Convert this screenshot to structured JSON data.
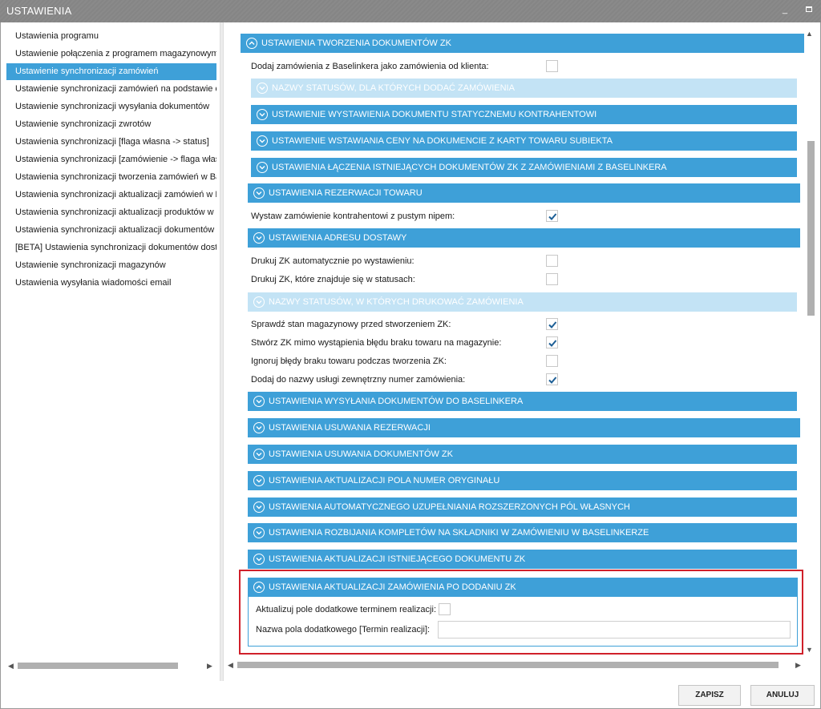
{
  "window": {
    "title": "USTAWIENIA",
    "min_symbol": "_"
  },
  "sidebar": {
    "items": [
      {
        "label": "Ustawienia programu"
      },
      {
        "label": "Ustawienie połączenia z programem magazynowym"
      },
      {
        "label": "Ustawienie synchronizacji zamówień"
      },
      {
        "label": "Ustawienie synchronizacji zamówień na podstawie dzi"
      },
      {
        "label": "Ustawienie synchronizacji wysyłania dokumentów"
      },
      {
        "label": "Ustawienie synchronizacji zwrotów"
      },
      {
        "label": "Ustawienia synchronizacji [flaga własna -> status]"
      },
      {
        "label": "Ustawienia synchronizacji [zamówienie -> flaga własn"
      },
      {
        "label": "Ustawienia synchronizacji tworzenia zamówień w Base"
      },
      {
        "label": "Ustawienia synchronizacji aktualizacji zamówień w Bas"
      },
      {
        "label": "Ustawienia synchronizacji aktualizacji produktów w Ba"
      },
      {
        "label": "Ustawienia synchronizacji aktualizacji dokumentów"
      },
      {
        "label": "[BETA] Ustawienia synchronizacji dokumentów dostaw"
      },
      {
        "label": "Ustawienie synchronizacji magazynów"
      },
      {
        "label": "Ustawienia wysyłania wiadomości email"
      }
    ],
    "active_index": 2
  },
  "main": {
    "header_tworzenie": "USTAWIENIA TWORZENIA DOKUMENTÓW ZK",
    "dodaj_label": "Dodaj zamówienia z Baselinkera jako zamówienia od klienta:",
    "sec_statusy_dodac": "NAZWY STATUSÓW, DLA KTÓRYCH DODAĆ ZAMÓWIENIA",
    "sec_statyczny": "USTAWIENIE WYSTAWIENIA DOKUMENTU STATYCZNEMU KONTRAHENTOWI",
    "sec_ceny": "USTAWIENIE WSTAWIANIA CENY NA DOKUMENCIE Z KARTY TOWARU SUBIEKTA",
    "sec_laczenie": "USTAWIENIA ŁĄCZENIA ISTNIEJĄCYCH DOKUMENTÓW ZK Z ZAMÓWIENIAMI Z BASELINKERA",
    "sec_rezerwacja": "USTAWIENIA REZERWACJI TOWARU",
    "nip_label": "Wystaw zamówienie kontrahentowi z pustym nipem:",
    "sec_adres": "USTAWIENIA ADRESU DOSTAWY",
    "drukuj_auto_label": "Drukuj ZK automatycznie po wystawieniu:",
    "drukuj_status_label": "Drukuj ZK, które znajduje się w statusach:",
    "sec_statusy_drukowac": "NAZWY STATUSÓW, W KTÓRYCH DRUKOWAĆ ZAMÓWIENIA",
    "stan_label": "Sprawdź stan magazynowy przed stworzeniem ZK:",
    "stworz_label": "Stwórz ZK mimo wystąpienia błędu braku towaru na magazynie:",
    "ignoruj_label": "Ignoruj błędy braku towaru podczas tworzenia ZK:",
    "numer_label": "Dodaj do nazwy usługi zewnętrzny numer zamówienia:",
    "sec_wysylania": "USTAWIENIA WYSYŁANIA DOKUMENTÓW DO BASELINKERA",
    "sec_usuwania_rez": "USTAWIENIA USUWANIA REZERWACJI",
    "sec_usuwania_zk": "USTAWIENIA USUWANIA DOKUMENTÓW ZK",
    "sec_numer_oryg": "USTAWIENIA AKTUALIZACJI POLA NUMER ORYGINAŁU",
    "sec_rozszerzone": "USTAWIENIA AUTOMATYCZNEGO UZUPEŁNIANIA ROZSZERZONYCH PÓL WŁASNYCH",
    "sec_komplety": "USTAWIENIA ROZBIJANIA KOMPLETÓW NA SKŁADNIKI W ZAMÓWIENIU W BASELINKERZE",
    "sec_istniejacy": "USTAWIENIA AKTUALIZACJI ISTNIEJĄCEGO DOKUMENTU ZK",
    "sec_po_dodaniu": "USTAWIENIA AKTUALIZACJI ZAMÓWIENIA PO DODANIU ZK",
    "aktualizuj_label": "Aktualizuj pole dodatkowe terminem realizacji:",
    "nazwa_pola_label": "Nazwa pola dodatkowego [Termin realizacji]:",
    "nazwa_pola_value": ""
  },
  "checkboxes": {
    "dodaj": false,
    "nip": true,
    "drukuj_auto": false,
    "drukuj_status": false,
    "stan": true,
    "stworz": true,
    "ignoruj": false,
    "numer": true,
    "aktualizuj": false
  },
  "footer": {
    "save_label": "ZAPISZ",
    "cancel_label": "ANULUJ"
  },
  "colors": {
    "accent": "#3ea0d8",
    "accent_light": "#c3e3f5",
    "highlight_border": "#d0202a",
    "titlebar": "#888888"
  }
}
